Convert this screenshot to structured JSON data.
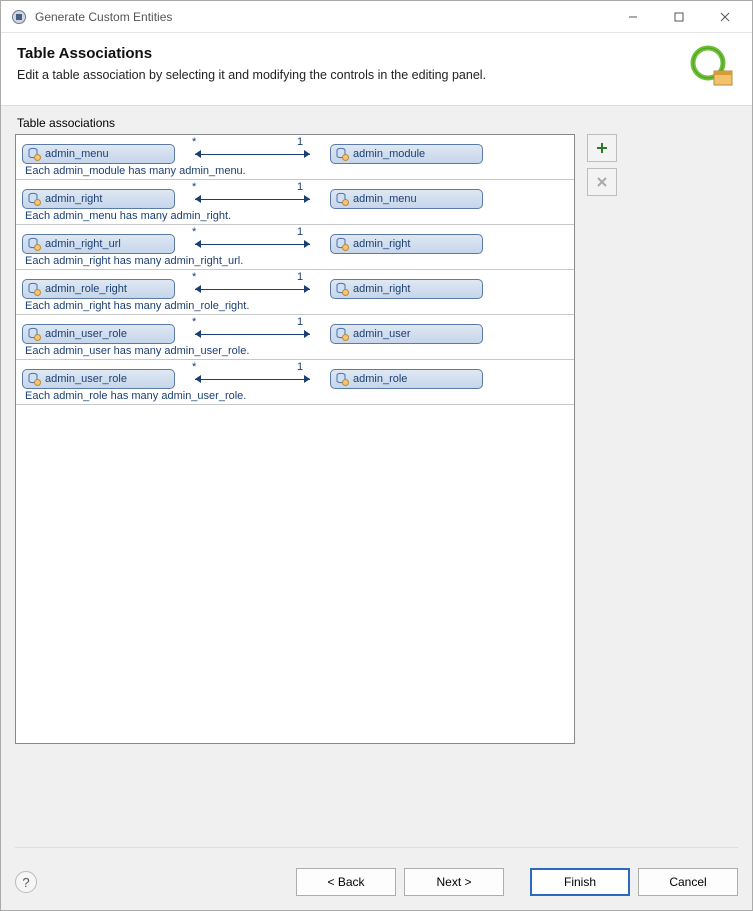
{
  "window": {
    "title": "Generate Custom Entities"
  },
  "header": {
    "title": "Table Associations",
    "subtitle": "Edit a table association by selecting it and modifying the controls in the editing panel."
  },
  "section_label": "Table associations",
  "associations": [
    {
      "left": "admin_menu",
      "leftCard": "*",
      "rightCard": "1",
      "right": "admin_module",
      "desc": "Each admin_module has many admin_menu."
    },
    {
      "left": "admin_right",
      "leftCard": "*",
      "rightCard": "1",
      "right": "admin_menu",
      "desc": "Each admin_menu has many admin_right."
    },
    {
      "left": "admin_right_url",
      "leftCard": "*",
      "rightCard": "1",
      "right": "admin_right",
      "desc": "Each admin_right has many admin_right_url."
    },
    {
      "left": "admin_role_right",
      "leftCard": "*",
      "rightCard": "1",
      "right": "admin_right",
      "desc": "Each admin_right has many admin_role_right."
    },
    {
      "left": "admin_user_role",
      "leftCard": "*",
      "rightCard": "1",
      "right": "admin_user",
      "desc": "Each admin_user has many admin_user_role."
    },
    {
      "left": "admin_user_role",
      "leftCard": "*",
      "rightCard": "1",
      "right": "admin_role",
      "desc": "Each admin_role has many admin_user_role."
    }
  ],
  "buttons": {
    "back": "< Back",
    "next": "Next >",
    "finish": "Finish",
    "cancel": "Cancel"
  }
}
